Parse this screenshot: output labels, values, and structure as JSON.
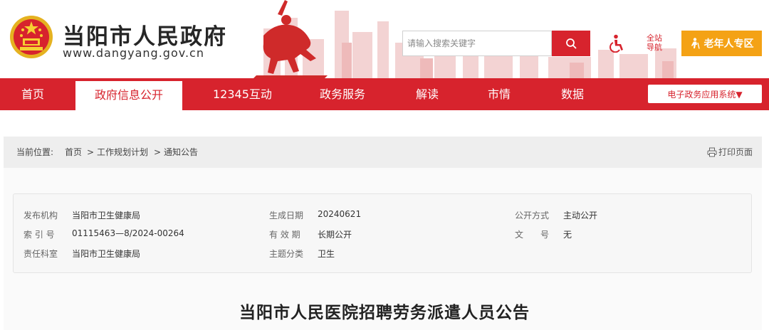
{
  "header": {
    "site_name": "当阳市人民政府",
    "site_url": "www.dangyang.gov.cn",
    "search_placeholder": "请输入搜索关键字",
    "site_nav_label": "全站导航",
    "elder_zone_label": "老年人专区",
    "brand_color": "#d7232d",
    "elder_color": "#f4a215"
  },
  "nav": {
    "items": [
      "首页",
      "政府信息公开",
      "12345互动",
      "政务服务",
      "解读",
      "市情",
      "数据"
    ],
    "active": "政府信息公开",
    "dropdown_label": "电子政务应用系统▼"
  },
  "breadcrumb": {
    "prefix": "当前位置:",
    "items": [
      "首页",
      "工作规划计划",
      "通知公告"
    ],
    "separator": ">",
    "print_label": "打印页面"
  },
  "meta": {
    "publisher_label": "发布机构",
    "publisher": "当阳市卫生健康局",
    "index_label": "索 引 号",
    "index": "01115463—8/2024-00264",
    "dept_label": "责任科室",
    "dept": "当阳市卫生健康局",
    "date_label": "生成日期",
    "date": "20240621",
    "validity_label": "有 效 期",
    "validity": "长期公开",
    "topic_label": "主题分类",
    "topic": "卫生",
    "disclosure_label": "公开方式",
    "disclosure": "主动公开",
    "doc_no_label": "文　　号",
    "doc_no": "无"
  },
  "article": {
    "title": "当阳市人民医院招聘劳务派遣人员公告"
  }
}
